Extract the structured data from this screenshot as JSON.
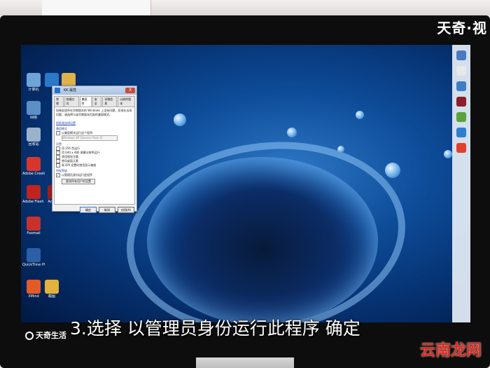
{
  "watermark_top": "天奇·视",
  "caption": "3.选择 以管理员身份运行此程序 确定",
  "logo_bottom_left": "天奇生活",
  "logo_bottom_right": "云南龙网",
  "dialog": {
    "title": "KK 属性",
    "close": "X",
    "tabs": [
      "常规",
      "快捷方式",
      "兼容性",
      "安全",
      "详细信息",
      "以前的版本"
    ],
    "active_tab": "兼容性",
    "intro": "如果此程序在早期版本的 Windows 上没有问题，而现在出现问题，请选择与该早期版本匹配的兼容模式。",
    "help_link": "帮助我选择设置",
    "compat_group": "兼容模式",
    "compat_check": "以兼容模式运行这个程序:",
    "compat_select": "Windows XP (Service Pack 3)",
    "settings_group": "设置",
    "settings": [
      "用 256 色运行",
      "用 640 x 480 屏幕分辨率运行",
      "禁用视觉主题",
      "禁用桌面元素",
      "高 DPI 设置时禁用显示缩放"
    ],
    "priv_group": "特权等级",
    "priv_check": "以管理员身份运行此程序",
    "all_users_button": "更改所有用户的设置",
    "buttons": {
      "ok": "确定",
      "cancel": "取消",
      "apply": "应用(A)"
    }
  },
  "desktop_icons": [
    {
      "label": "计算机",
      "color": "#6fa4d8"
    },
    {
      "label": "",
      "color": "#2c78c8"
    },
    {
      "label": "",
      "color": "#e0b24a"
    },
    {
      "label": "网络",
      "color": "#5d8fc6"
    },
    {
      "label": "回收站",
      "color": "#9ab3cb"
    },
    {
      "label": "Adobe Creati...",
      "color": "#d8362b"
    },
    {
      "label": "Adobe Flash Professional",
      "color": "#c1231f"
    },
    {
      "label": "Acrobat",
      "color": "#9f1c1c"
    },
    {
      "label": "Foxmail",
      "color": "#c8322b"
    },
    {
      "label": "QuickTime Player",
      "color": "#2b5fa6"
    },
    {
      "label": "XMind",
      "color": "#e45a27"
    },
    {
      "label": "截图",
      "color": "#e2b23d"
    }
  ],
  "sidebar_icons": [
    "#4a7ac2",
    "#e8e8e8",
    "#3f7ec7",
    "#8a1e2a",
    "#5aa33b",
    "#2f7fd0",
    "#e0402c"
  ],
  "colors": {
    "accent": "#2a6fc7",
    "caption": "#ffffff",
    "logo_red": "#e02a1f"
  }
}
